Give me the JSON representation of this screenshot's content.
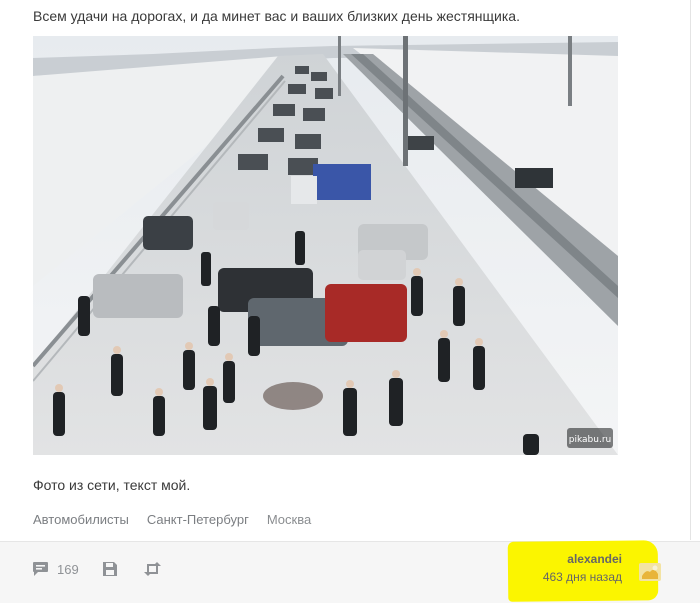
{
  "post": {
    "intro": "Всем удачи на дорогах, и да минет вас и ваших близких день жестянщика.",
    "caption": "Фото из сети, текст мой.",
    "watermark": "pikabu.ru"
  },
  "tags": [
    "Автомобилисты",
    "Санкт-Петербург",
    "Москва"
  ],
  "footer": {
    "comments_count": "169",
    "author": "alexandei",
    "posted_ago": "463 дня назад"
  },
  "colors": {
    "highlight": "#fbf500",
    "footer_bg": "#f6f6f6",
    "icon_gray": "#8f9296"
  }
}
